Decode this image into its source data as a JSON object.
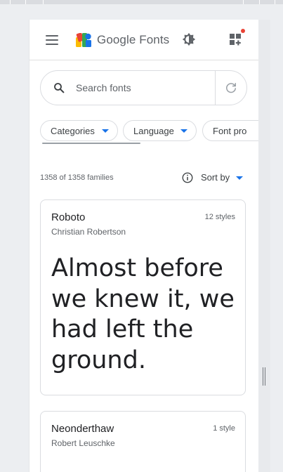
{
  "header": {
    "brand_google": "Google",
    "brand_fonts": "Fonts",
    "menu_icon": "hamburger-menu-icon",
    "theme_icon": "brightness-icon",
    "apps_icon": "apps-grid-icon",
    "notification_dot_color": "#ea4335"
  },
  "search": {
    "placeholder": "Search fonts",
    "value": "",
    "icon": "search-icon",
    "refresh_icon": "refresh-icon"
  },
  "filters": {
    "chips": [
      {
        "label": "Categories"
      },
      {
        "label": "Language"
      },
      {
        "label": "Font pro"
      }
    ],
    "accent_color": "#1a73e8"
  },
  "results": {
    "count_text": "1358 of 1358 families",
    "sort_label": "Sort by"
  },
  "cards": [
    {
      "name": "Roboto",
      "author": "Christian Robertson",
      "styles": "12 styles",
      "sample": "Almost before we knew it, we had left the ground."
    },
    {
      "name": "Neonderthaw",
      "author": "Robert Leuschke",
      "styles": "1 style",
      "sample": ""
    }
  ]
}
